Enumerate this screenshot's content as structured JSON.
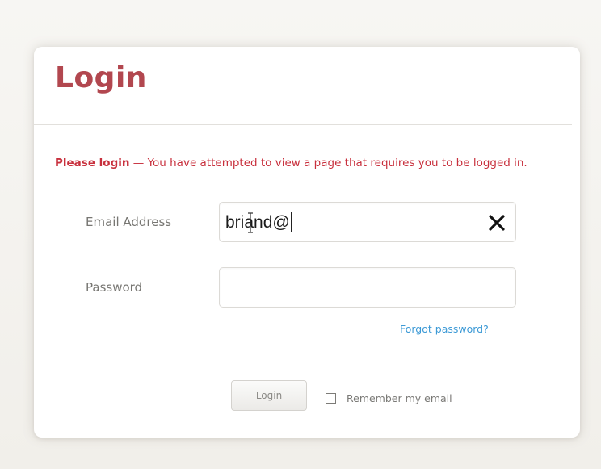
{
  "login": {
    "title": "Login",
    "alert": {
      "strong": "Please login",
      "message": " — You have attempted to view a page that requires you to be logged in."
    },
    "email": {
      "label": "Email Address",
      "value": "briand@",
      "clear_icon": "close-x-icon"
    },
    "password": {
      "label": "Password",
      "value": ""
    },
    "forgot_link": "Forgot password?",
    "submit_label": "Login",
    "remember": {
      "label": "Remember my email",
      "checked": false
    }
  },
  "colors": {
    "title": "#b2474f",
    "alert": "#c8303d",
    "link": "#3d9ad6",
    "label": "#777672"
  }
}
